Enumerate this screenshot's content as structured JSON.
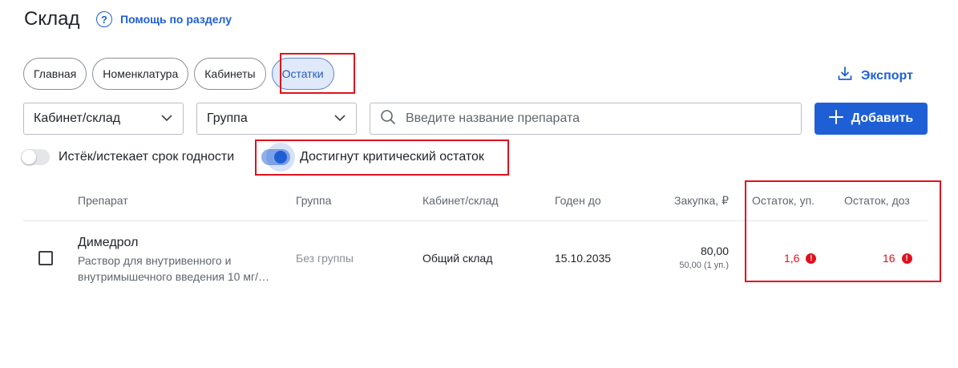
{
  "header": {
    "title": "Склад",
    "help_label": "Помощь по разделу",
    "help_icon": "question-circle-icon"
  },
  "tabs": [
    {
      "label": "Главная",
      "active": false
    },
    {
      "label": "Номенклатура",
      "active": false
    },
    {
      "label": "Кабинеты",
      "active": false
    },
    {
      "label": "Остатки",
      "active": true
    }
  ],
  "export": {
    "label": "Экспорт",
    "icon": "download-icon"
  },
  "filters": {
    "cabinet_select": "Кабинет/склад",
    "group_select": "Группа",
    "search_placeholder": "Введите название препарата",
    "add_button": "Добавить"
  },
  "toggles": [
    {
      "label": "Истёк/истекает срок годности",
      "on": false
    },
    {
      "label": "Достигнут критический остаток",
      "on": true
    }
  ],
  "table": {
    "columns": [
      "Препарат",
      "Группа",
      "Кабинет/склад",
      "Годен до",
      "Закупка, ₽",
      "Остаток, уп.",
      "Остаток, доз"
    ],
    "rows": [
      {
        "name": "Димедрол",
        "description": "Раствор для внутривенного и внутримышечного введения 10 мг/…",
        "group": "Без группы",
        "cabinet": "Общий склад",
        "expires": "15.10.2035",
        "price": "80,00",
        "price_per_unit": "50,00 (1 уп.)",
        "remain_units": "1,6",
        "remain_doses": "16",
        "checked": false
      }
    ]
  },
  "colors": {
    "accent": "#1f5fd6",
    "warning": "#e0111d",
    "highlight_box": "#e0111d",
    "active_tab_bg": "#dfe9fa"
  }
}
